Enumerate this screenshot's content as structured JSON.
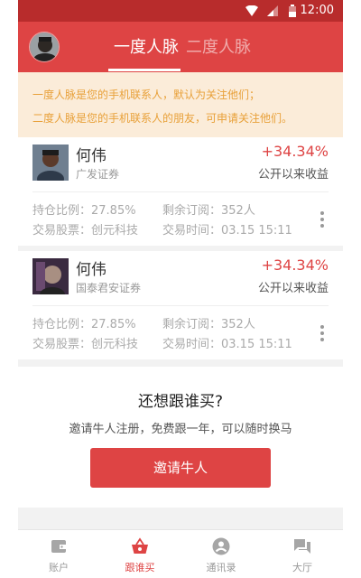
{
  "status_bar": {
    "time": "12:00"
  },
  "header": {
    "tabs": [
      {
        "label": "一度人脉",
        "active": true
      },
      {
        "label": "二度人脉",
        "active": false
      }
    ]
  },
  "notice": {
    "line1": "一度人脉是您的手机联系人，默认为关注他们；",
    "line2": "二度人脉是您的手机联系人的朋友，可申请关注他们。"
  },
  "cards": [
    {
      "name": "何伟",
      "broker": "广发证券",
      "return_pct": "+34.34%",
      "return_label": "公开以来收益",
      "position_ratio": "持仓比例：27.85%",
      "remaining_subs": "剩余订阅：352人",
      "stock": "交易股票：创元科技",
      "trade_time": "交易时间：03.15 15:11"
    },
    {
      "name": "何伟",
      "broker": "国泰君安证券",
      "return_pct": "+34.34%",
      "return_label": "公开以来收益",
      "position_ratio": "持仓比例：27.85%",
      "remaining_subs": "剩余订阅：352人",
      "stock": "交易股票：创元科技",
      "trade_time": "交易时间：03.15 15:11"
    }
  ],
  "invite": {
    "title": "还想跟谁买?",
    "subtitle": "邀请牛人注册，免费跟一年，可以随时换马",
    "button_label": "邀请牛人"
  },
  "bottom_nav": [
    {
      "label": "账户",
      "icon": "wallet-icon",
      "active": false
    },
    {
      "label": "跟谁买",
      "icon": "basket-icon",
      "active": true
    },
    {
      "label": "通讯录",
      "icon": "contact-icon",
      "active": false
    },
    {
      "label": "大厅",
      "icon": "chat-icon",
      "active": false
    }
  ],
  "colors": {
    "brand_red": "#de4444",
    "status_bar": "#b82c2c",
    "notice_bg": "#fbecd9",
    "notice_text": "#e8a038"
  }
}
